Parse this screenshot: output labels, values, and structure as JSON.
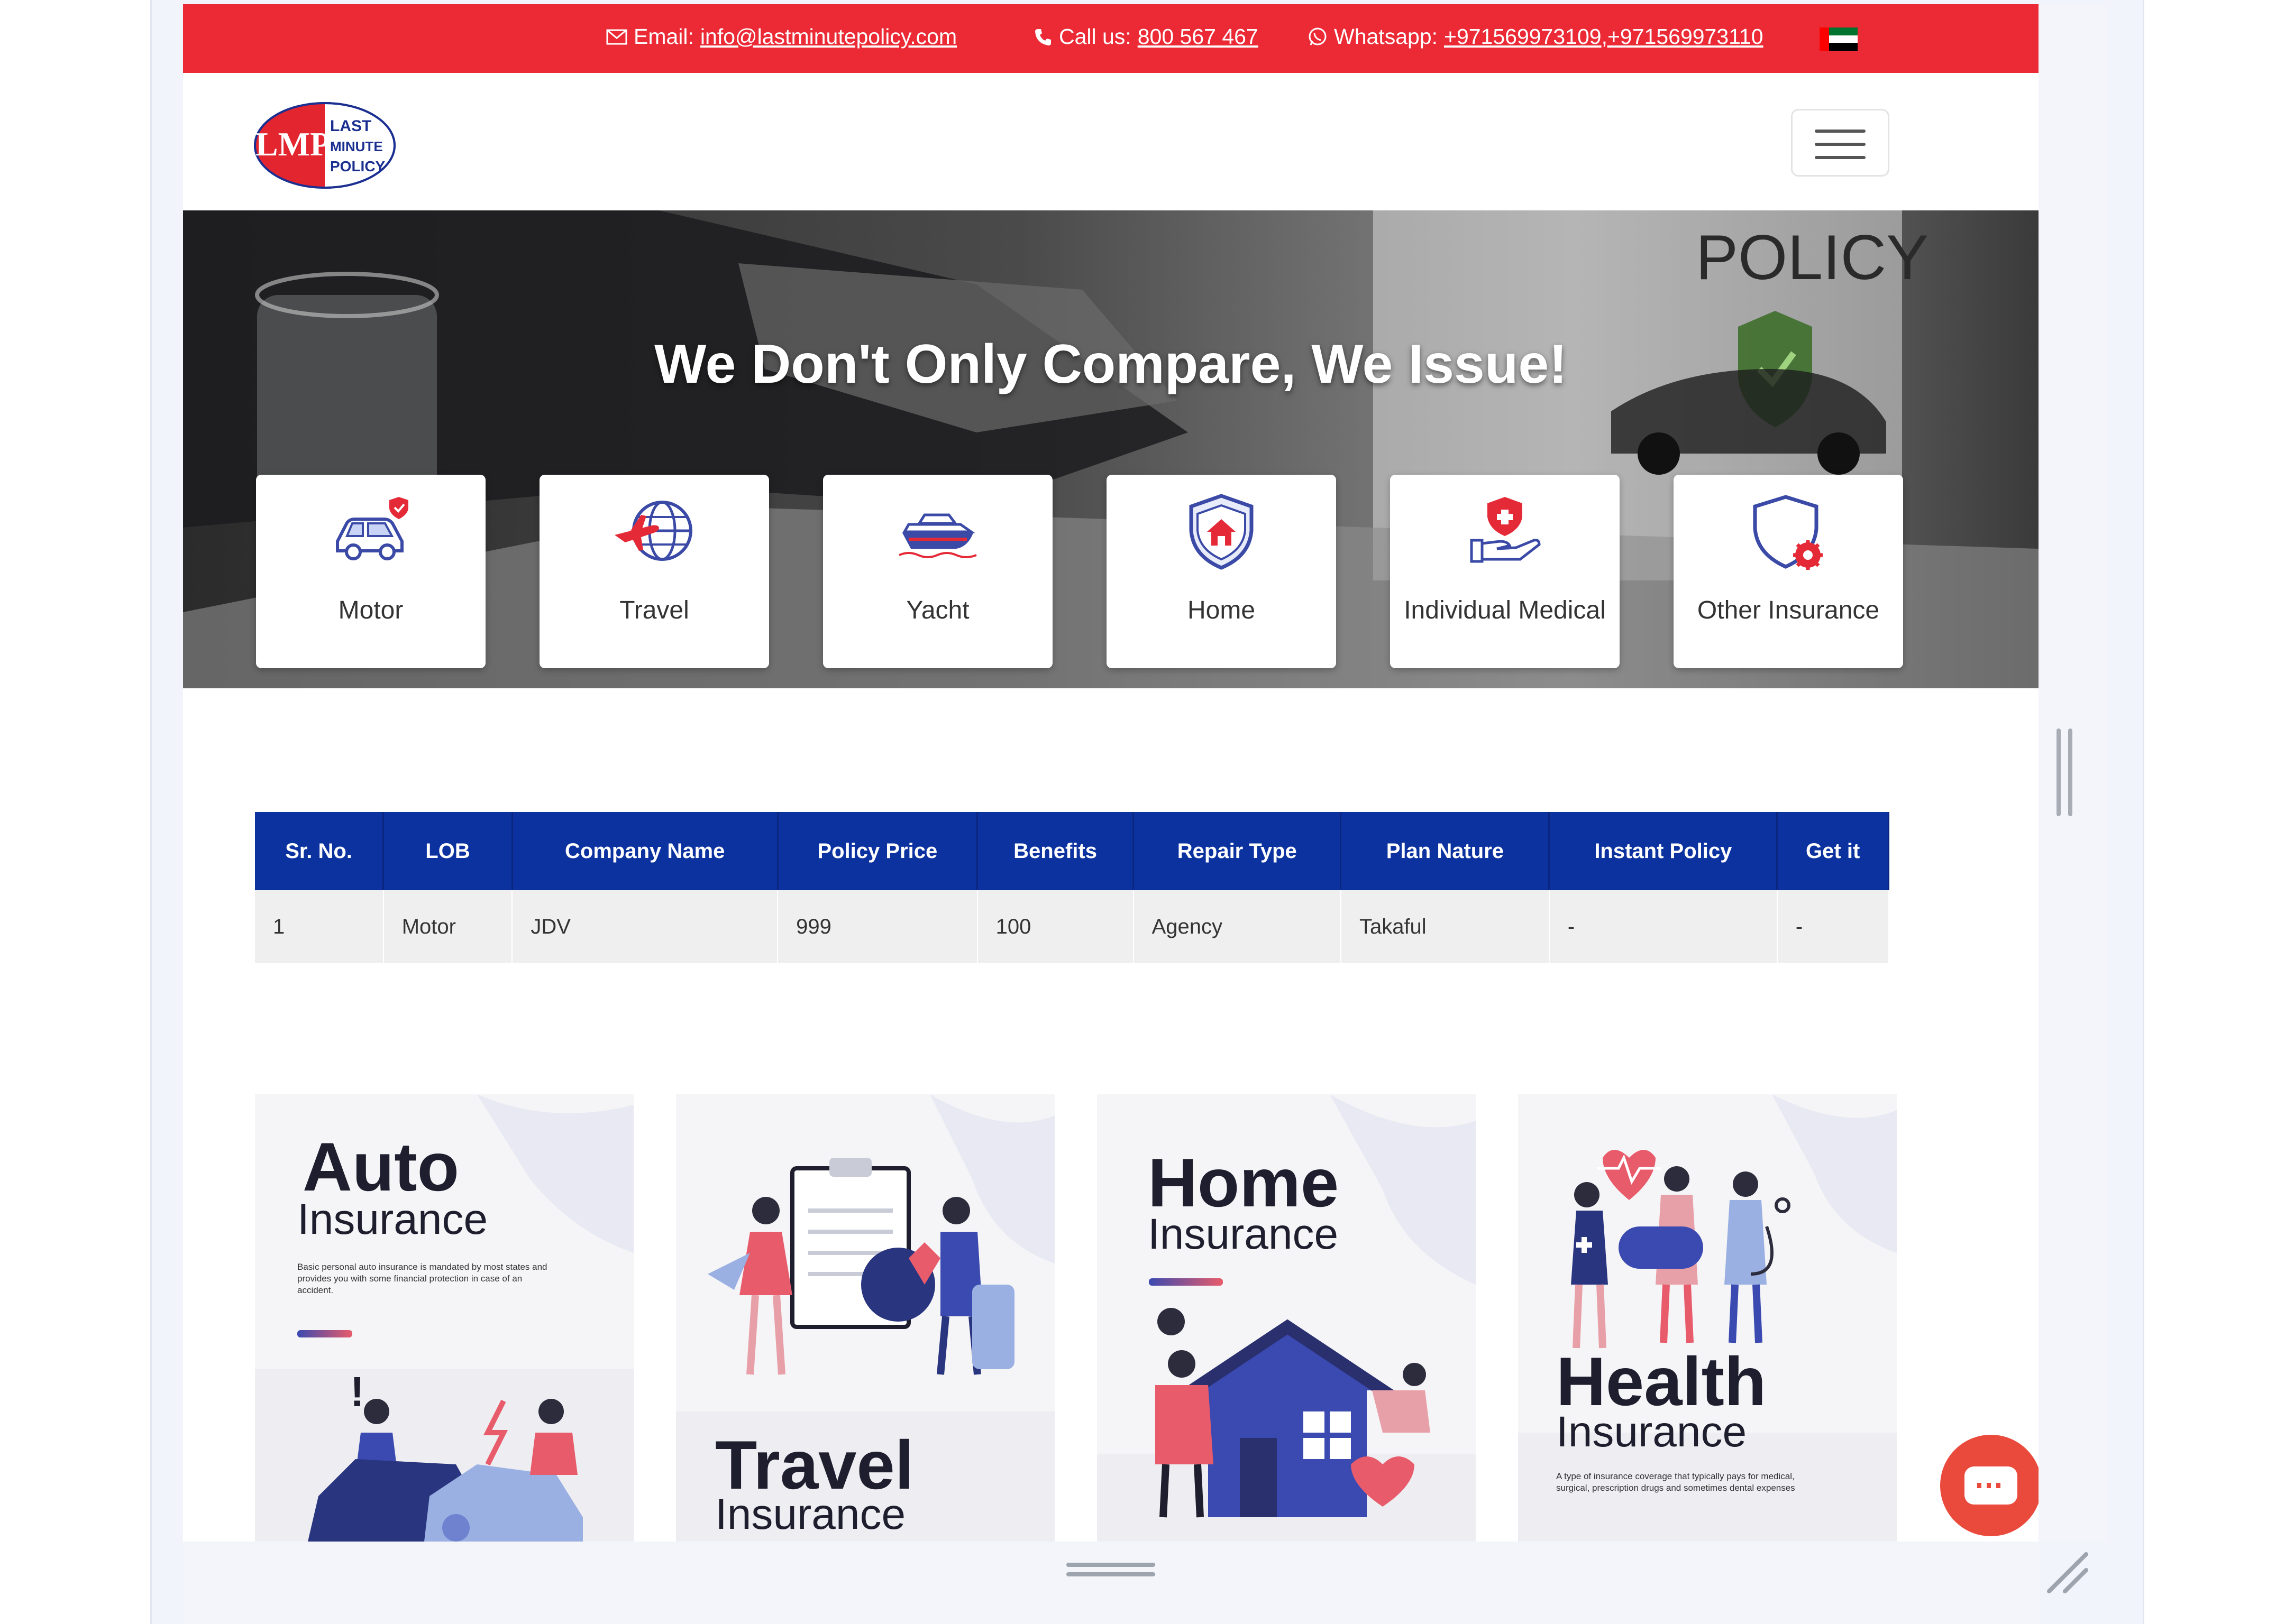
{
  "topbar": {
    "email_label": "Email:",
    "email": "info@lastminutepolicy.com",
    "call_label": "Call us:",
    "phone": "800 567 467",
    "whatsapp_label": "Whatsapp:",
    "whatsapp_1": "+971569973109",
    "whatsapp_sep": " ,",
    "whatsapp_2": "+971569973110"
  },
  "logo": {
    "letters_1": "LAST",
    "letters_2": "MINUTE",
    "letters_3": "POLICY",
    "mark": "LMP"
  },
  "hero": {
    "title": "We Don't Only Compare, We Issue!",
    "background_text": "POLICY",
    "cards": [
      {
        "label": "Motor",
        "icon": "car-icon"
      },
      {
        "label": "Travel",
        "icon": "plane-globe-icon"
      },
      {
        "label": "Yacht",
        "icon": "yacht-icon"
      },
      {
        "label": "Home",
        "icon": "home-shield-icon"
      },
      {
        "label": "Individual Medical",
        "icon": "medical-hand-icon"
      },
      {
        "label": "Other Insurance",
        "icon": "shield-gear-icon"
      }
    ]
  },
  "table": {
    "headers": [
      "Sr. No.",
      "LOB",
      "Company Name",
      "Policy Price",
      "Benefits",
      "Repair Type",
      "Plan Nature",
      "Instant Policy",
      "Get it"
    ],
    "rows": [
      [
        "1",
        "Motor",
        "JDV",
        "999",
        "100",
        "Agency",
        "Takaful",
        "-",
        "-"
      ]
    ]
  },
  "promos": [
    {
      "title": "Auto",
      "subtitle": "Insurance",
      "text": "Basic personal auto insurance is mandated by most states and provides you with some financial protection in case of an accident."
    },
    {
      "title": "Travel",
      "subtitle": "Insurance"
    },
    {
      "title": "Home",
      "subtitle": "Insurance"
    },
    {
      "title": "Health",
      "subtitle": "Insurance",
      "text": "A type of insurance coverage that typically pays for medical, surgical, prescription drugs and sometimes dental expenses"
    }
  ],
  "colors": {
    "brand_red": "#eb2a36",
    "table_header": "#0c32a0",
    "accent_blue": "#3b4ab0"
  }
}
